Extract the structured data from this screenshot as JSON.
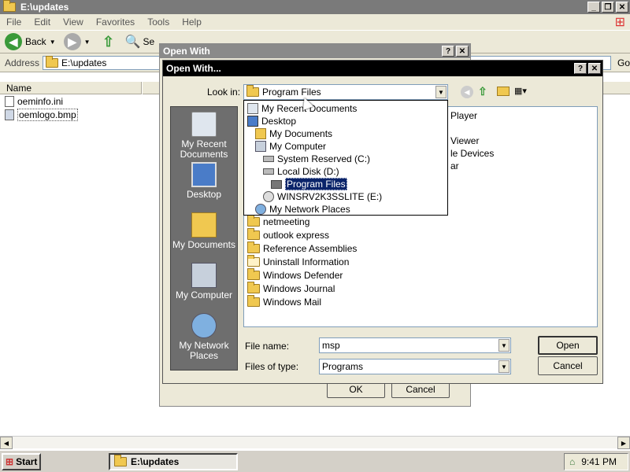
{
  "explorer": {
    "title": "E:\\updates",
    "menu": [
      "File",
      "Edit",
      "View",
      "Favorites",
      "Tools",
      "Help"
    ],
    "back_label": "Back",
    "search_fragment": "Se",
    "address_label": "Address",
    "address_value": "E:\\updates",
    "go_label": "Go",
    "column_name": "Name",
    "files": [
      "oeminfo.ini",
      "oemlogo.bmp"
    ]
  },
  "open_with_outer": {
    "title": "Open With",
    "ok_label": "OK",
    "cancel_label": "Cancel"
  },
  "open_dialog": {
    "title": "Open With...",
    "look_in_label": "Look in:",
    "look_in_value": "Program Files",
    "places": [
      "My Recent Documents",
      "Desktop",
      "My Documents",
      "My Computer",
      "My Network Places"
    ],
    "dropdown_items": [
      {
        "label": "My Recent Documents",
        "icon": "recent-icon"
      },
      {
        "label": "Desktop",
        "icon": "desktop-icon"
      },
      {
        "label": "My Documents",
        "icon": "documents-icon"
      },
      {
        "label": "My Computer",
        "icon": "computer-icon"
      },
      {
        "label": "System Reserved (C:)",
        "icon": "drive-icon"
      },
      {
        "label": "Local Disk (D:)",
        "icon": "drive-icon"
      },
      {
        "label": "Program Files",
        "icon": "folder-icon"
      },
      {
        "label": "WINSRV2K3SSLITE (E:)",
        "icon": "cd-drive-icon"
      },
      {
        "label": "My Network Places",
        "icon": "network-icon"
      }
    ],
    "partial_items": [
      "Player",
      "Viewer",
      "le Devices",
      "ar"
    ],
    "folders": [
      "netmeeting",
      "outlook express",
      "Reference Assemblies",
      "Uninstall Information",
      "Windows Defender",
      "Windows Journal",
      "Windows Mail"
    ],
    "file_name_label": "File name:",
    "file_name_value": "msp",
    "file_type_label": "Files of type:",
    "file_type_value": "Programs",
    "open_label": "Open",
    "cancel_label": "Cancel"
  },
  "taskbar": {
    "start_label": "Start",
    "task_label": "E:\\updates",
    "clock": "9:41 PM"
  }
}
